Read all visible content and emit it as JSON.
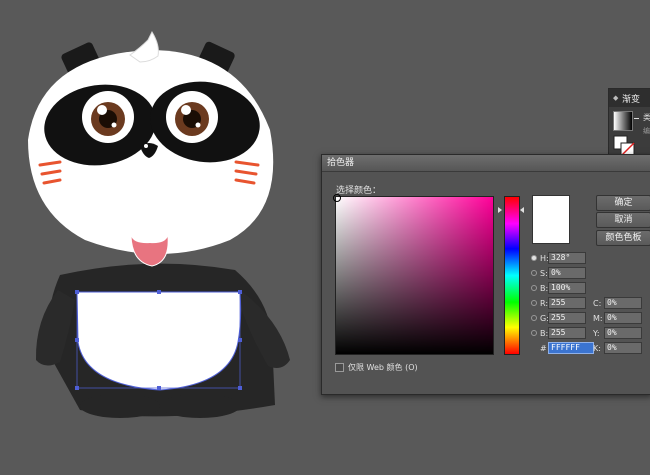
{
  "panel": {
    "tab_label": "渐变",
    "type_label": "类",
    "edit_label": "编"
  },
  "dialog": {
    "title": "拾色器",
    "select_color_label": "选择颜色：",
    "buttons": {
      "ok": "确定",
      "cancel": "取消",
      "swatches": "颜色色板"
    },
    "fields": {
      "H": {
        "label": "H:",
        "value": "328°"
      },
      "S": {
        "label": "S:",
        "value": "0%"
      },
      "B": {
        "label": "B:",
        "value": "100%"
      },
      "R": {
        "label": "R:",
        "value": "255"
      },
      "G": {
        "label": "G:",
        "value": "255"
      },
      "Bl": {
        "label": "B:",
        "value": "255"
      },
      "hex": {
        "label": "#",
        "value": "FFFFFF"
      },
      "C": {
        "label": "C:",
        "value": "0%"
      },
      "M": {
        "label": "M:",
        "value": "0%"
      },
      "Y": {
        "label": "Y:",
        "value": "0%"
      },
      "K": {
        "label": "K:",
        "value": "0%"
      }
    },
    "web_only_label": "仅限 Web 颜色 (O)",
    "current_color": "#FFFFFF",
    "hue_color": "#FF0099"
  },
  "artwork": {
    "panda_black": "#1a1a1a",
    "cheek_color": "#e8542f",
    "mouth_color": "#e87480",
    "selection_color": "#4f5fd6"
  }
}
